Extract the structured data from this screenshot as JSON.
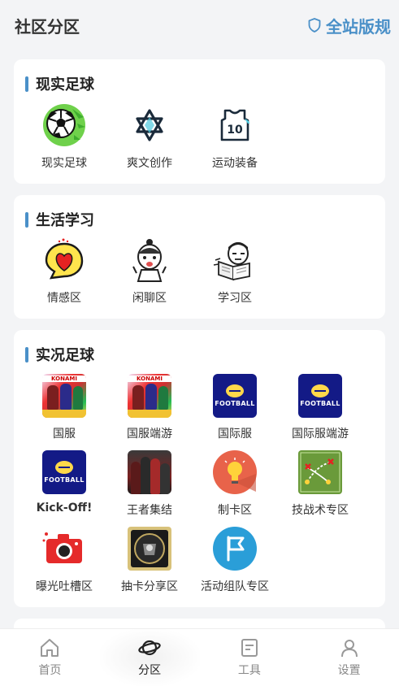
{
  "header": {
    "title": "社区分区",
    "rules_label": "全站版规"
  },
  "sections": [
    {
      "title": "现实足球",
      "items": [
        {
          "label": "现实足球",
          "icon": "soccer-ball-icon"
        },
        {
          "label": "爽文创作",
          "icon": "star-of-david-icon"
        },
        {
          "label": "运动装备",
          "icon": "jersey-10-icon",
          "number": "10"
        }
      ]
    },
    {
      "title": "生活学习",
      "items": [
        {
          "label": "情感区",
          "icon": "heart-bubble-icon"
        },
        {
          "label": "闲聊区",
          "icon": "cartoon-character-icon"
        },
        {
          "label": "学习区",
          "icon": "reading-character-icon"
        }
      ]
    },
    {
      "title": "实况足球",
      "items": [
        {
          "label": "国服",
          "icon": "konami-anniversary-icon",
          "brand": "KONAMI"
        },
        {
          "label": "国服端游",
          "icon": "konami-anniversary-icon",
          "brand": "KONAMI"
        },
        {
          "label": "国际服",
          "icon": "efootball-icon",
          "brand": "FOOTBALL"
        },
        {
          "label": "国际服端游",
          "icon": "efootball-icon",
          "brand": "FOOTBALL"
        },
        {
          "label": "Kick-Off!",
          "icon": "efootball-icon",
          "brand": "FOOTBALL"
        },
        {
          "label": "王者集结",
          "icon": "players-photo-icon"
        },
        {
          "label": "制卡区",
          "icon": "lightbulb-icon"
        },
        {
          "label": "技战术专区",
          "icon": "tactics-board-icon"
        },
        {
          "label": "曝光吐槽区",
          "icon": "camera-icon"
        },
        {
          "label": "抽卡分享区",
          "icon": "card-pack-icon"
        },
        {
          "label": "活动组队专区",
          "icon": "flag-icon"
        }
      ]
    }
  ],
  "nav": [
    {
      "label": "首页",
      "icon": "home-icon",
      "active": false
    },
    {
      "label": "分区",
      "icon": "planet-icon",
      "active": true
    },
    {
      "label": "工具",
      "icon": "document-icon",
      "active": false
    },
    {
      "label": "设置",
      "icon": "user-icon",
      "active": false
    }
  ],
  "colors": {
    "accent": "#4a90c8",
    "background": "#f3f4f6",
    "card": "#ffffff"
  }
}
